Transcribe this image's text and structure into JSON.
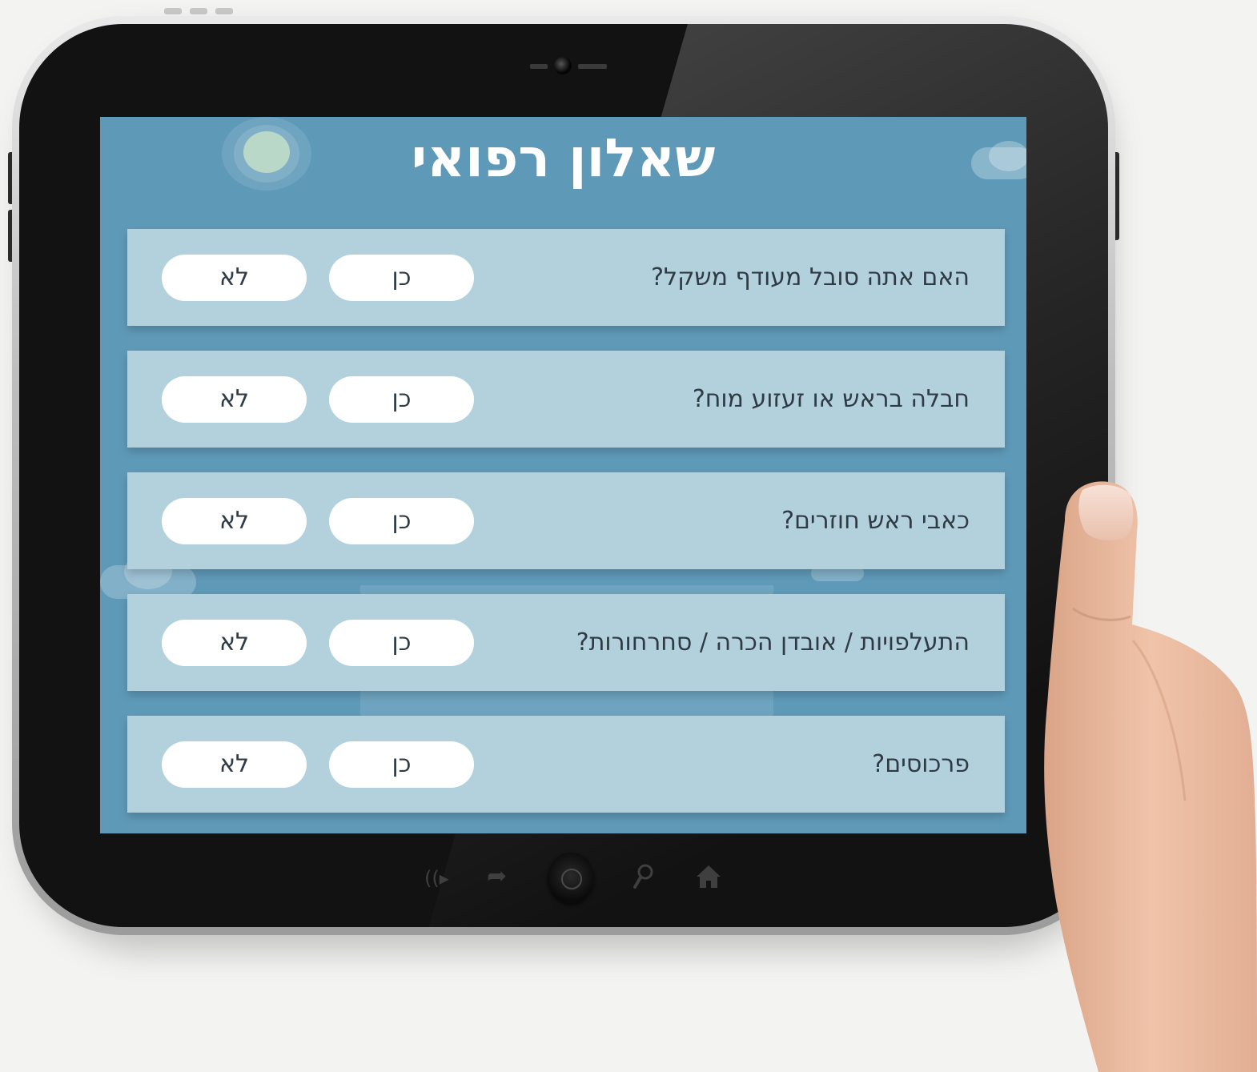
{
  "screen": {
    "title": "שאלון רפואי",
    "background_color": "#5e9ab8",
    "questions": [
      {
        "text": "האם אתה סובל מעודף משקל?",
        "yes_label": "כן",
        "no_label": "לא"
      },
      {
        "text": "חבלה בראש או זעזוע מוח?",
        "yes_label": "כן",
        "no_label": "לא"
      },
      {
        "text": "כאבי ראש חוזרים?",
        "yes_label": "כן",
        "no_label": "לא"
      },
      {
        "text": "התעלפויות / אובדן הכרה / סחרחורות?",
        "yes_label": "כן",
        "no_label": "לא"
      },
      {
        "text": "פרכוסים?",
        "yes_label": "כן",
        "no_label": "לא"
      }
    ]
  },
  "device_nav": {
    "icons": [
      "speaker-icon",
      "share-icon",
      "home-button",
      "search-icon",
      "home-icon"
    ]
  }
}
